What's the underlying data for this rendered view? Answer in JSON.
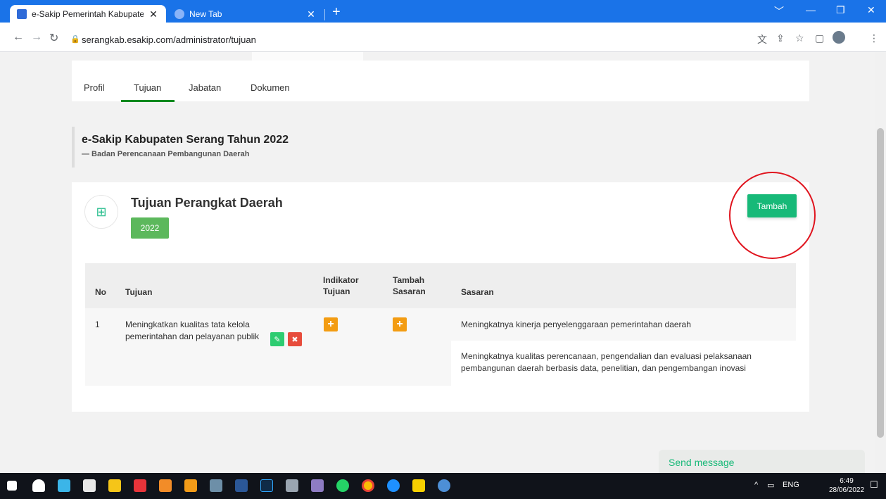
{
  "browser": {
    "tabs": [
      {
        "title": "e-Sakip Pemerintah Kabupaten S",
        "close": "✕"
      },
      {
        "title": "New Tab",
        "close": "✕"
      }
    ],
    "new_tab": "+",
    "url": "serangkab.esakip.com/administrator/tujuan",
    "window_controls": [
      "﹀",
      "—",
      "❐",
      "✕"
    ]
  },
  "nav_tabs": [
    "Profil",
    "Tujuan",
    "Jabatan",
    "Dokumen"
  ],
  "heading": {
    "title": "e-Sakip Kabupaten Serang Tahun 2022",
    "subtitle": "— Badan Perencanaan Pembangunan Daerah"
  },
  "card": {
    "title": "Tujuan Perangkat Daerah",
    "year": "2022",
    "add_button": "Tambah"
  },
  "table": {
    "headers": {
      "no": "No",
      "tujuan": "Tujuan",
      "indikator_line1": "Indikator",
      "indikator_line2": "Tujuan",
      "tambah_line1": "Tambah",
      "tambah_line2": "Sasaran",
      "sasaran": "Sasaran"
    },
    "rows": [
      {
        "no": "1",
        "tujuan_line1": "Meningkatkan kualitas tata kelola",
        "tujuan_line2": "pemerintahan dan pelayanan publik",
        "sasaran": [
          {
            "line1": "Meningkatnya kinerja penyelenggaraan pemerintahan daerah",
            "line2": ""
          },
          {
            "line1": "Meningkatnya kualitas perencanaan, pengendalian dan evaluasi pelaksanaan",
            "line2": "pembangunan daerah berbasis data, penelitian, dan pengembangan inovasi"
          }
        ]
      }
    ]
  },
  "chat": {
    "label": "Send message"
  },
  "taskbar": {
    "tray_lang": "ENG",
    "time": "6:49",
    "date": "28/06/2022"
  },
  "colors": {
    "chrome_blue": "#1a73e8",
    "accent_green": "#17b978",
    "badge_green": "#5cb85c",
    "plus_orange": "#f39c12",
    "edit_green": "#2ecc71",
    "delete_red": "#e74c3c",
    "annotation_red": "#e0141e"
  }
}
